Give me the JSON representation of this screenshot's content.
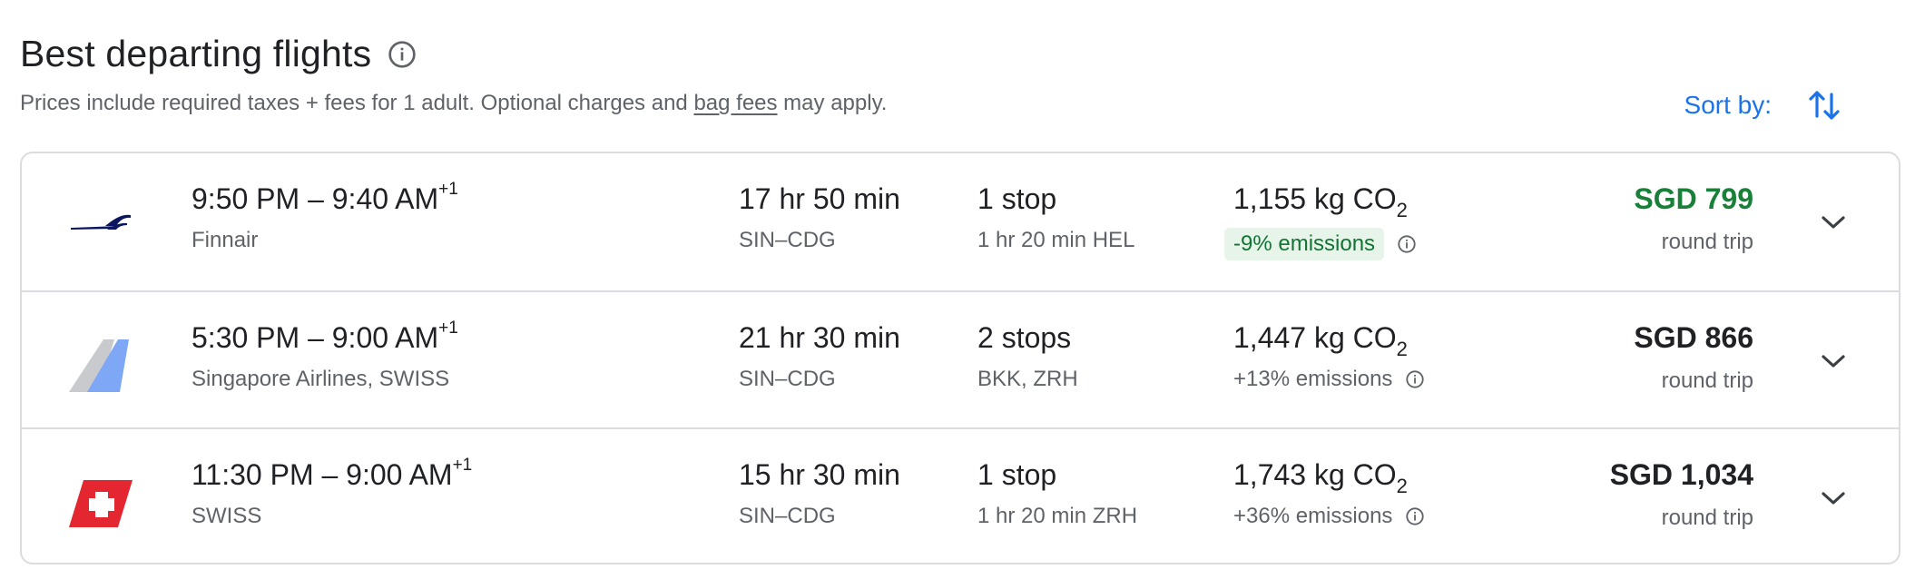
{
  "header": {
    "title": "Best departing flights",
    "subtitle_before": "Prices include required taxes + fees for 1 adult. Optional charges and ",
    "subtitle_link": "bag fees",
    "subtitle_after": " may apply.",
    "sort_label": "Sort by:"
  },
  "flights": [
    {
      "times": "9:50 PM – 9:40 AM",
      "day_offset": "+1",
      "airline": "Finnair",
      "duration": "17 hr 50 min",
      "route": "SIN–CDG",
      "stops": "1 stop",
      "stop_detail": "1 hr 20 min HEL",
      "co2_value": "1,155 kg CO",
      "co2_sub": "2",
      "emissions": "-9% emissions",
      "price": "SGD 799",
      "price_type": "round trip",
      "logo_icon": "finnair-logo-icon",
      "price_color": "#188038"
    },
    {
      "times": "5:30 PM – 9:00 AM",
      "day_offset": "+1",
      "airline": "Singapore Airlines, SWISS",
      "duration": "21 hr 30 min",
      "route": "SIN–CDG",
      "stops": "2 stops",
      "stop_detail": "BKK, ZRH",
      "co2_value": "1,447 kg CO",
      "co2_sub": "2",
      "emissions": "+13% emissions",
      "price": "SGD 866",
      "price_type": "round trip",
      "logo_icon": "multi-airline-logo-icon"
    },
    {
      "times": "11:30 PM – 9:00 AM",
      "day_offset": "+1",
      "airline": "SWISS",
      "duration": "15 hr 30 min",
      "route": "SIN–CDG",
      "stops": "1 stop",
      "stop_detail": "1 hr 20 min ZRH",
      "co2_value": "1,743 kg CO",
      "co2_sub": "2",
      "emissions": "+36% emissions",
      "price": "SGD 1,034",
      "price_type": "round trip",
      "logo_icon": "swiss-logo-icon"
    }
  ],
  "colors": {
    "accent": "#1a73e8",
    "good_price": "#188038",
    "emissions_pill_bg": "#e6f4ea",
    "emissions_pill_text": "#137333"
  }
}
